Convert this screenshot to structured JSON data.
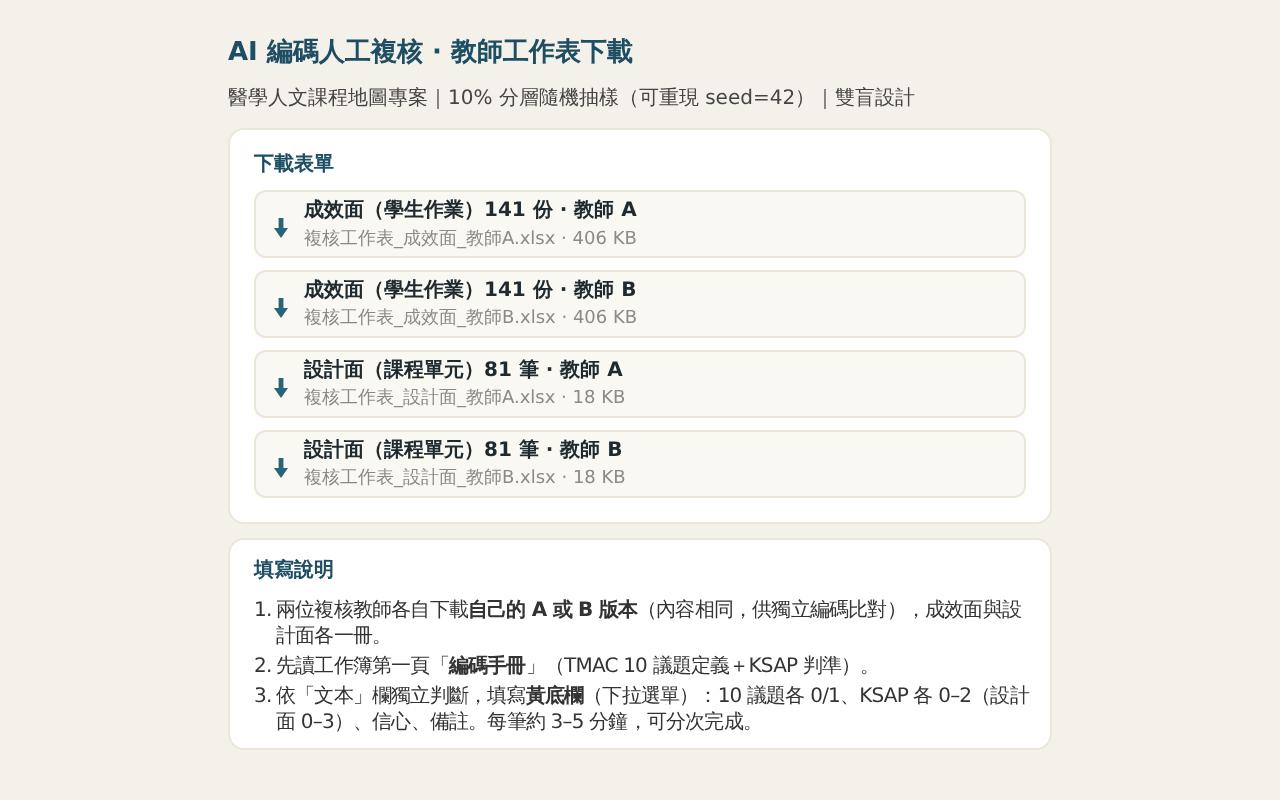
{
  "title": "AI 編碼人工複核 · 教師工作表下載",
  "subtitle": "醫學人文課程地圖專案｜10% 分層隨機抽樣（可重現 seed=42）｜雙盲設計",
  "downloads": {
    "heading": "下載表單",
    "items": [
      {
        "label": "成效面（學生作業）141 份 · 教師 A",
        "file": "複核工作表_成效面_教師A.xlsx · 406 KB"
      },
      {
        "label": "成效面（學生作業）141 份 · 教師 B",
        "file": "複核工作表_成效面_教師B.xlsx · 406 KB"
      },
      {
        "label": "設計面（課程單元）81 筆 · 教師 A",
        "file": "複核工作表_設計面_教師A.xlsx · 18 KB"
      },
      {
        "label": "設計面（課程單元）81 筆 · 教師 B",
        "file": "複核工作表_設計面_教師B.xlsx · 18 KB"
      }
    ]
  },
  "instructions": {
    "heading": "填寫說明",
    "items": [
      {
        "number": "1.",
        "text": "兩位複核教師各自下載**自己的 A 或 B 版本**（內容相同，供獨立編碼比對），成效面與設計面各一冊。"
      },
      {
        "number": "2.",
        "text": "先讀工作簿第一頁「**編碼手冊**」（TMAC 10 議題定義＋KSAP 判準）。"
      },
      {
        "number": "3.",
        "text": "依「文本」欄獨立判斷，填寫**黃底欄**（下拉選單）：10 議題各 0/1、KSAP 各 0–2（設計面 0–3）、信心、備註。每筆約 3–5 分鐘，可分次完成。"
      }
    ]
  }
}
